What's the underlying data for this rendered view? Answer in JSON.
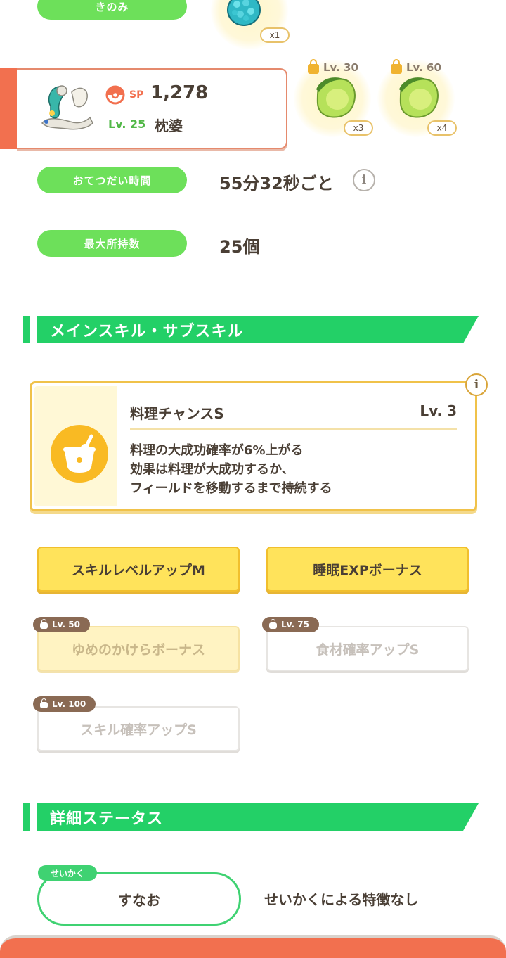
{
  "top": {
    "berry_label": "きのみ",
    "berry_count": "x1",
    "ingredients": [
      {
        "lock_level": "Lv. 30",
        "count": "x3"
      },
      {
        "lock_level": "Lv. 60",
        "count": "x4"
      }
    ]
  },
  "pokemon": {
    "sp_label": "SP",
    "sp_value": "1,278",
    "level": "Lv. 25",
    "name": "枕婆"
  },
  "help_time": {
    "label": "おてつだい時間",
    "value": "55分32秒ごと",
    "info": "i"
  },
  "max_carry": {
    "label": "最大所持数",
    "value": "25個"
  },
  "skills_section": {
    "title": "メインスキル・サブスキル"
  },
  "main_skill": {
    "name": "料理チャンスS",
    "level": "Lv. 3",
    "description": [
      "料理の大成功確率が6%上がる",
      "効果は料理が大成功するか、",
      "フィールドを移動するまで持続する"
    ],
    "info": "i"
  },
  "sub_skills": [
    {
      "label": "スキルレベルアップM",
      "lock": ""
    },
    {
      "label": "睡眠EXPボーナス",
      "lock": ""
    },
    {
      "label": "ゆめのかけらボーナス",
      "lock": "Lv. 50"
    },
    {
      "label": "食材確率アップS",
      "lock": "Lv. 75"
    },
    {
      "label": "スキル確率アップS",
      "lock": "Lv. 100"
    }
  ],
  "detail_section": {
    "title": "詳細ステータス"
  },
  "nature": {
    "tag": "せいかく",
    "value": "すなお",
    "description": "せいかくによる特徴なし"
  },
  "colors": {
    "green_pill": "#6de05a",
    "section_green": "#23d067",
    "accent_orange": "#f2704f",
    "gold": "#f0c24a"
  }
}
